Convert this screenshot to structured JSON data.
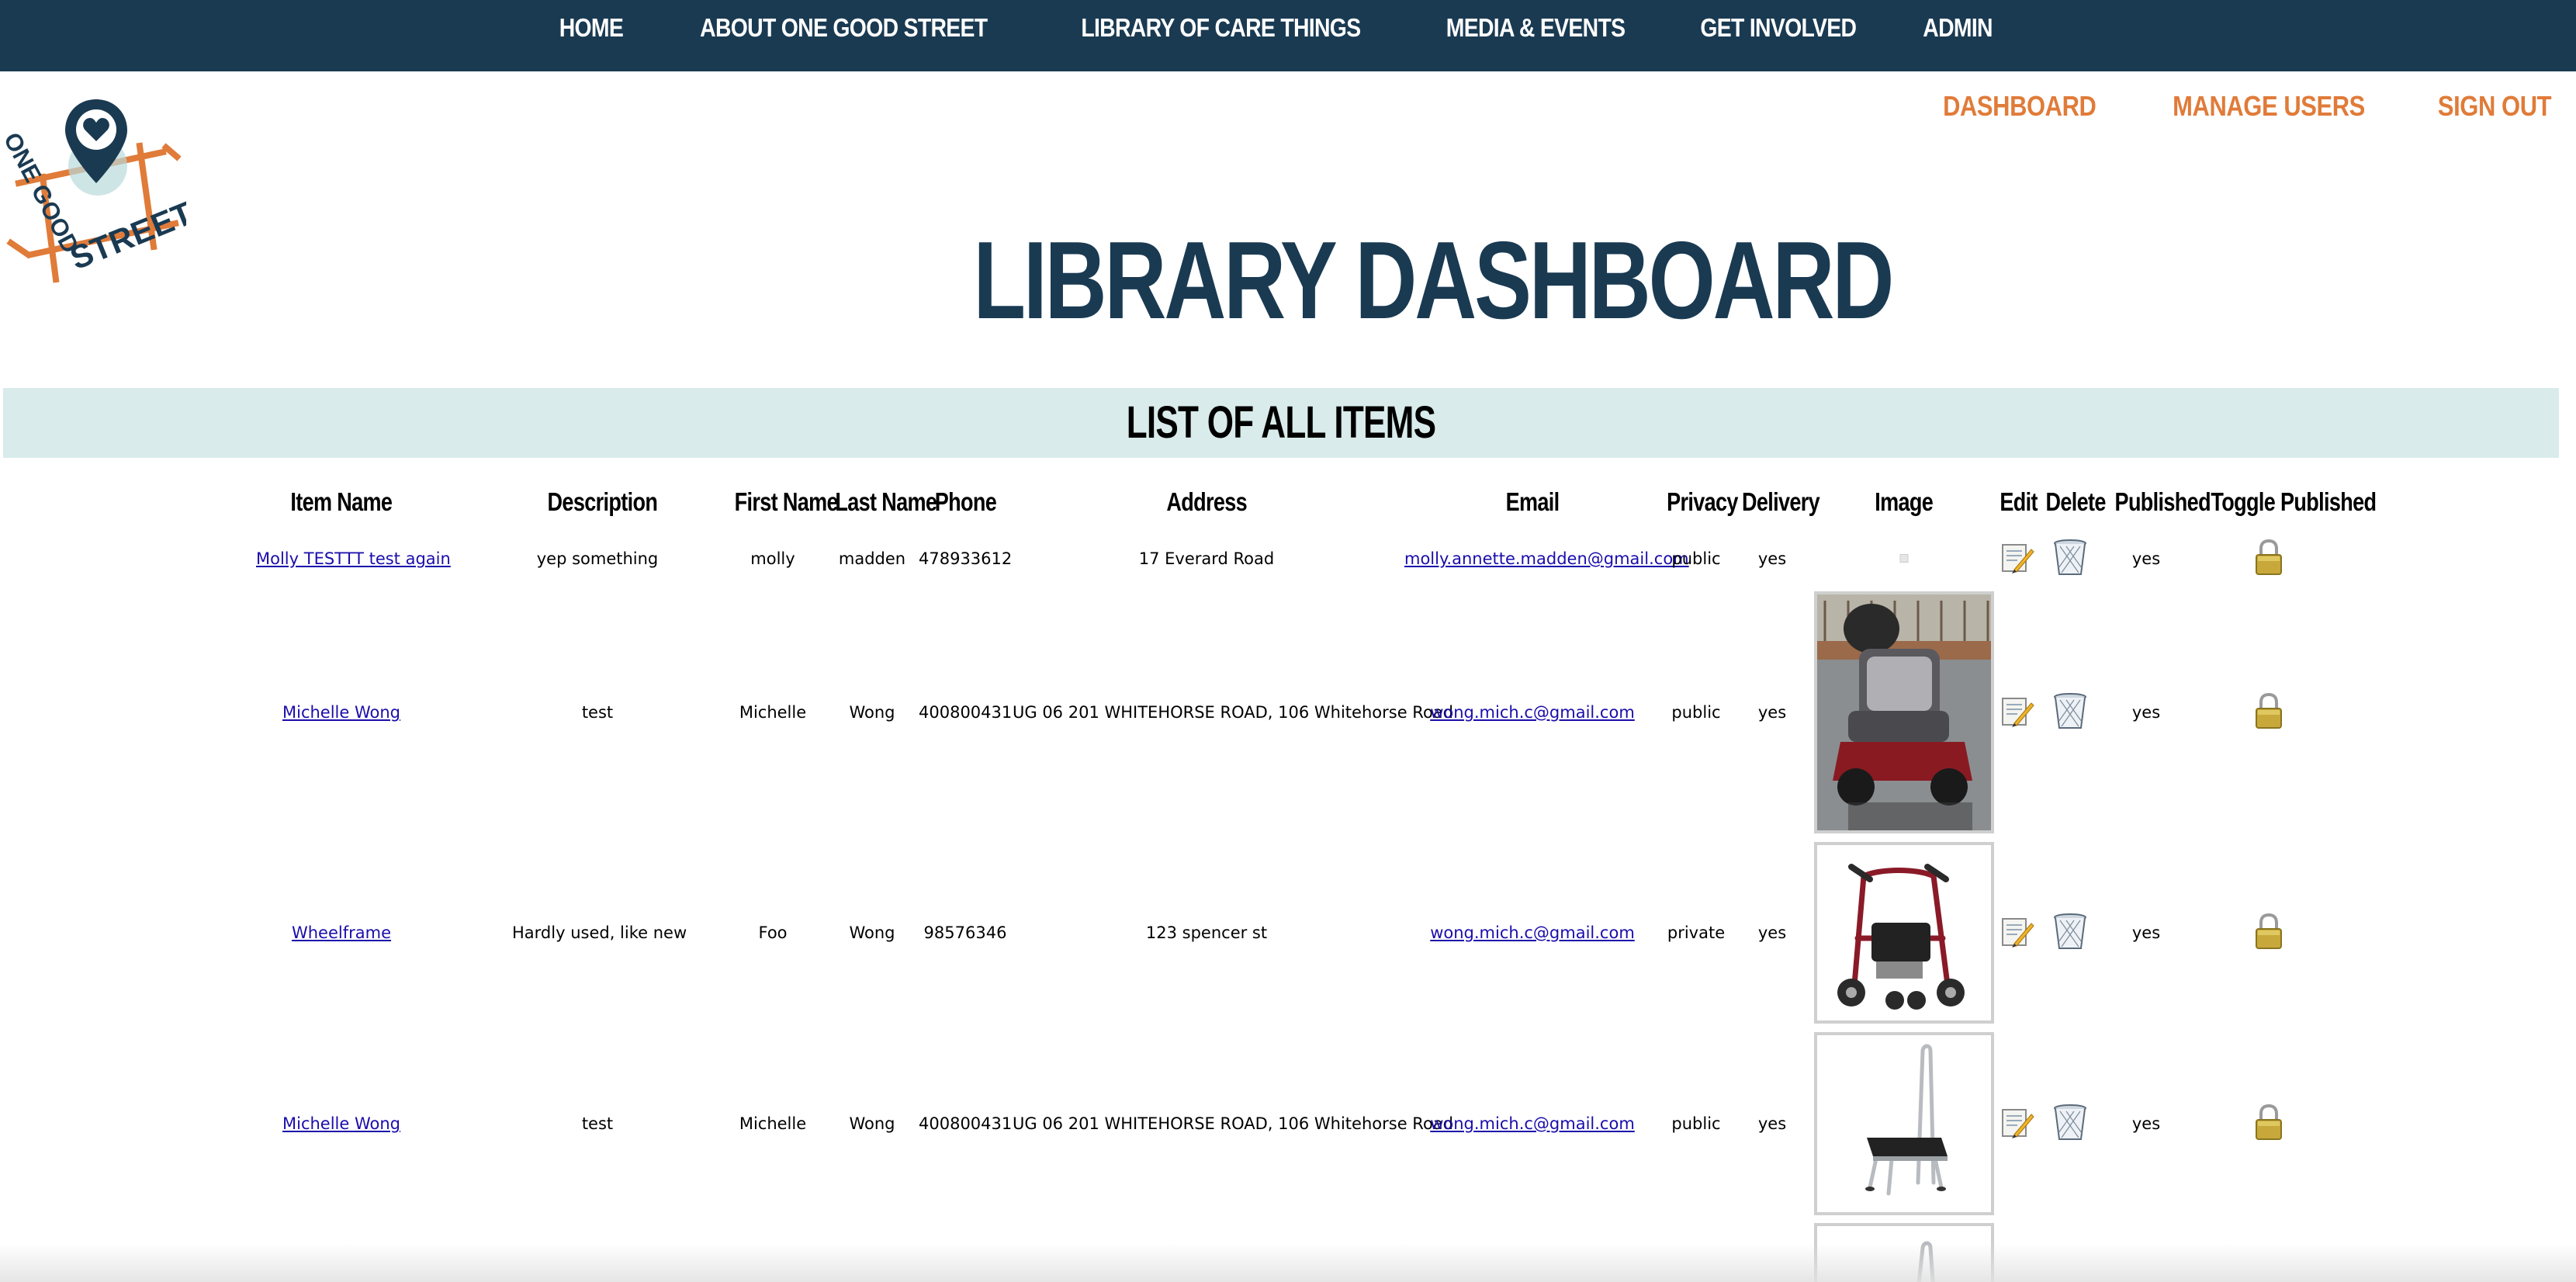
{
  "nav": {
    "items": [
      "HOME",
      "ABOUT ONE GOOD STREET",
      "LIBRARY OF CARE THINGS",
      "MEDIA & EVENTS",
      "GET INVOLVED",
      "ADMIN"
    ]
  },
  "logo": {
    "line1": "ONE GOOD",
    "line2": "STREET"
  },
  "subnav": {
    "dashboard": "DASHBOARD",
    "manage_users": "MANAGE USERS",
    "sign_out": "SIGN OUT"
  },
  "page": {
    "title": "LIBRARY DASHBOARD",
    "section_title": "LIST OF ALL ITEMS"
  },
  "table": {
    "headers": [
      "Item Name",
      "Description",
      "First Name",
      "Last Name",
      "Phone",
      "Address",
      "Email",
      "Privacy",
      "Delivery",
      "Image",
      "Edit",
      "Delete",
      "Published",
      "Toggle Published"
    ],
    "rows": [
      {
        "item_name": "Molly TESTTT test again",
        "description": "yep something",
        "first_name": "molly",
        "last_name": "madden",
        "phone": "478933612",
        "address": "17 Everard Road",
        "email": "molly.annette.madden@gmail.com",
        "privacy": "public",
        "delivery": "yes",
        "image": "broken-image-icon",
        "published": "yes"
      },
      {
        "item_name": "Michelle Wong",
        "description": "test",
        "first_name": "Michelle",
        "last_name": "Wong",
        "phone": "400800431",
        "address": "UG 06 201 WHITEHORSE ROAD, 106 Whitehorse Road",
        "email": "wong.mich.c@gmail.com",
        "privacy": "public",
        "delivery": "yes",
        "image": "mobility-scooter-photo",
        "published": "yes"
      },
      {
        "item_name": "Wheelframe",
        "description": "Hardly used, like new",
        "first_name": "Foo",
        "last_name": "Wong",
        "phone": "98576346",
        "address": "123 spencer st",
        "email": "wong.mich.c@gmail.com",
        "privacy": "private",
        "delivery": "yes",
        "image": "rollator-walker-photo",
        "published": "yes"
      },
      {
        "item_name": "Michelle Wong",
        "description": "test",
        "first_name": "Michelle",
        "last_name": "Wong",
        "phone": "400800431",
        "address": "UG 06 201 WHITEHORSE ROAD, 106 Whitehorse Road",
        "email": "wong.mich.c@gmail.com",
        "privacy": "public",
        "delivery": "yes",
        "image": "step-stool-photo",
        "published": "yes"
      }
    ]
  },
  "icons": {
    "edit": "pencil-note-icon",
    "delete": "trash-can-icon",
    "toggle": "padlock-icon"
  },
  "colors": {
    "navy": "#1a3a52",
    "orange": "#e07b39",
    "band": "#d9ebeb",
    "link": "#1a0dab"
  }
}
